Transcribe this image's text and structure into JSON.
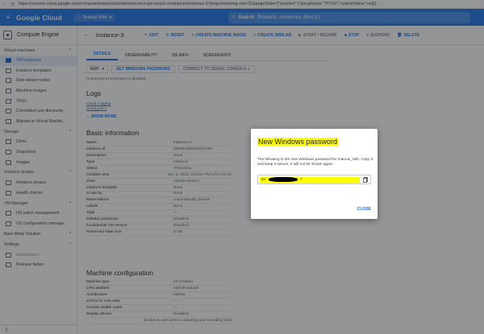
{
  "browser": {
    "url": "https://console.cloud.google.com/compute/instancesDetail/zones/europe-west3-c/instances/instance-3?project=testing-vms-01&pageState=(\"duration\":(\"groupValue\":\"PT1H\",\"customValue\":null))"
  },
  "header": {
    "logo": "Google Cloud",
    "project": "Testing VMs",
    "search_label": "Search",
    "search_placeholder": "Products, resources, docs (/)"
  },
  "sidebar": {
    "product": "Compute Engine",
    "groups": [
      {
        "title": "Virtual machines",
        "items": [
          {
            "label": "VM instances",
            "active": true
          },
          {
            "label": "Instance templates"
          },
          {
            "label": "Sole-tenant nodes"
          },
          {
            "label": "Machine images"
          },
          {
            "label": "TPUs"
          },
          {
            "label": "Committed use discounts"
          },
          {
            "label": "Migrate to Virtual Machin..."
          }
        ]
      },
      {
        "title": "Storage",
        "items": [
          {
            "label": "Disks"
          },
          {
            "label": "Snapshots"
          },
          {
            "label": "Images"
          }
        ]
      },
      {
        "title": "Instance groups",
        "items": [
          {
            "label": "Instance groups"
          },
          {
            "label": "Health checks"
          }
        ]
      },
      {
        "title": "VM Manager",
        "items": [
          {
            "label": "OS patch management"
          },
          {
            "label": "OS configuration manage..."
          }
        ]
      },
      {
        "title": "Bare Metal Solution",
        "items": []
      },
      {
        "title": "Settings",
        "items": [
          {
            "label": "Marketplace",
            "dim": true
          },
          {
            "label": "Release Notes"
          }
        ]
      }
    ],
    "collapse_glyph": "‹|"
  },
  "toolbar": {
    "back_glyph": "←",
    "title": "instance-3",
    "buttons": [
      {
        "label": "EDIT",
        "icon": "pencil-icon",
        "name": "edit-button"
      },
      {
        "label": "RESET",
        "icon": "reset-icon",
        "name": "reset-button"
      },
      {
        "label": "CREATE MACHINE IMAGE",
        "icon": "plus-icon",
        "name": "create-machine-image-button"
      },
      {
        "label": "CREATE SIMILAR",
        "icon": "plus-icon",
        "name": "create-similar-button"
      },
      {
        "label": "START / RESUME",
        "icon": "play-icon",
        "name": "start-resume-button",
        "disabled": true
      },
      {
        "label": "STOP",
        "icon": "stop-icon",
        "name": "stop-button"
      },
      {
        "label": "SUSPEND",
        "icon": "pause-icon",
        "name": "suspend-button",
        "disabled": true
      },
      {
        "label": "DELETE",
        "icon": "trash-icon",
        "name": "delete-button"
      }
    ]
  },
  "tabs": [
    "DETAILS",
    "OBSERVABILITY",
    "OS INFO",
    "SCREENSHOT"
  ],
  "connect": {
    "rdp_label": "RDP",
    "set_password": "SET WINDOWS PASSWORD",
    "serial_console": "CONNECT TO SERIAL CONSOLE",
    "hint": "Connecting to serial ports is disabled"
  },
  "logs": {
    "title": "Logs",
    "links": [
      "Cloud Logging",
      "Serial port 1"
    ],
    "show_more": "SHOW MORE"
  },
  "basic_info": {
    "title": "Basic information",
    "rows": [
      {
        "k": "Name",
        "v": "instance-3"
      },
      {
        "k": "Instance Id",
        "v": "885931666629264785"
      },
      {
        "k": "Description",
        "v": "None"
      },
      {
        "k": "Type",
        "v": "Instance"
      },
      {
        "k": "Status",
        "v": "Running"
      },
      {
        "k": "Creation time",
        "v": "Dec 3, 2022, 2:03:57 PM UTC+01:00"
      },
      {
        "k": "Zone",
        "v": "europe-west3-c"
      },
      {
        "k": "Instance template",
        "v": "None"
      },
      {
        "k": "In use by",
        "v": "None"
      },
      {
        "k": "Reservations",
        "v": "Automatically choose"
      },
      {
        "k": "Labels",
        "v": "None"
      },
      {
        "k": "Tags",
        "v": "—"
      },
      {
        "k": "Deletion protection",
        "v": "Disabled"
      },
      {
        "k": "Confidential VM service",
        "v": "Disabled"
      },
      {
        "k": "Preserved state size",
        "v": "0 GB"
      }
    ]
  },
  "machine_config": {
    "title": "Machine configuration",
    "rows": [
      {
        "k": "Machine type",
        "v": "e2-medium"
      },
      {
        "k": "CPU platform",
        "v": "Intel Broadwell"
      },
      {
        "k": "Architecture",
        "v": "x86/64"
      },
      {
        "k": "vCPUs to core ratio",
        "v": "—"
      },
      {
        "k": "Custom visible cores",
        "v": "—"
      },
      {
        "k": "Display device",
        "v": "Disabled"
      },
      {
        "k": "",
        "v": "Enable to use screen capturing and recording tools"
      }
    ]
  },
  "dialog": {
    "title": "New Windows password",
    "text": "The following is the new Windows password for marcus_rath. Copy it and keep it secure. It will not be shown again.",
    "password_visible_prefix": "5s",
    "password_visible_suffix": "7",
    "close_label": "CLOSE",
    "highlight_color": "#ffff00"
  }
}
